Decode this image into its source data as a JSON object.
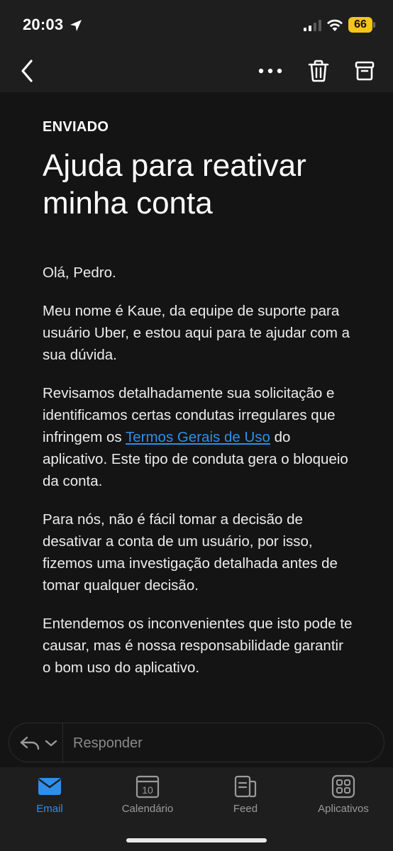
{
  "status_bar": {
    "time": "20:03",
    "battery_level": "66",
    "battery_color": "#f5c518"
  },
  "toolbar": {
    "icons": [
      "back-chevron-icon",
      "more-icon",
      "trash-icon",
      "archive-icon"
    ]
  },
  "message": {
    "folder": "ENVIADO",
    "subject": "Ajuda para reativar minha conta",
    "greeting": "Olá, Pedro.",
    "paragraph_1": "Meu nome é Kaue, da equipe de suporte para usuário Uber, e estou aqui para te ajudar com a sua dúvida.",
    "paragraph_2_before": "Revisamos detalhadamente sua solicitação e identificamos certas condutas irregulares que infringem os ",
    "paragraph_2_link": "Termos Gerais de Uso",
    "paragraph_2_after": " do aplicativo. Este tipo de conduta gera o bloqueio da conta.",
    "paragraph_3": "Para nós, não é fácil tomar a decisão de desativar a conta de um usuário, por isso, fizemos uma investigação detalhada antes de tomar qualquer decisão.",
    "paragraph_4": "Entendemos os inconvenientes que isto pode te causar, mas é nossa responsabilidade garantir o bom uso do aplicativo."
  },
  "reply": {
    "placeholder": "Responder"
  },
  "tabs": [
    {
      "label": "Email",
      "icon": "mail-icon"
    },
    {
      "label": "Calendário",
      "icon": "calendar-icon",
      "day": "10"
    },
    {
      "label": "Feed",
      "icon": "feed-icon"
    },
    {
      "label": "Aplicativos",
      "icon": "apps-icon"
    }
  ],
  "colors": {
    "accent": "#2f8fe8",
    "background": "#141414",
    "chrome": "#1e1e1e"
  }
}
